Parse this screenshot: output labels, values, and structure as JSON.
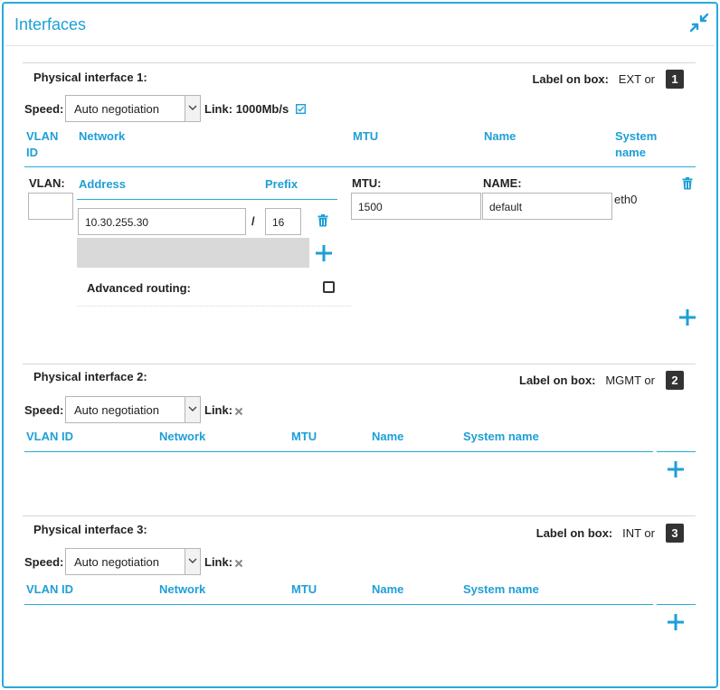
{
  "panel": {
    "title": "Interfaces"
  },
  "icons": {
    "collapse": "collapse-arrows-icon",
    "trash": "trash-icon",
    "plus": "plus-icon",
    "link_checked": "checked-box-icon",
    "link_down": "x-icon"
  },
  "colors": {
    "accent": "#1e9fd6",
    "badge": "#333333"
  },
  "common": {
    "speed_label": "Speed:",
    "link_label": "Link:",
    "label_on_box": "Label on box:",
    "vlan_id": "VLAN ID",
    "network": "Network",
    "mtu": "MTU",
    "name": "Name",
    "system_name": "System name",
    "speed_value": "Auto negotiation"
  },
  "interfaces": [
    {
      "title": "Physical interface 1:",
      "label_value": "EXT or",
      "badge": "1",
      "link_value": "1000Mb/s",
      "columns": {
        "vlan_id": "VLAN ID",
        "network": "Network",
        "mtu": "MTU",
        "name": "Name",
        "system_name": "System name"
      },
      "row": {
        "vlan_label": "VLAN:",
        "vlan_value": "",
        "address_header": "Address",
        "prefix_header": "Prefix",
        "address_value": "10.30.255.30",
        "separator": "/",
        "prefix_value": "16",
        "advanced_routing_label": "Advanced routing:",
        "advanced_routing_checked": false,
        "mtu_label": "MTU:",
        "mtu_value": "1500",
        "name_label": "NAME:",
        "name_value": "default",
        "system_name": "eth0"
      }
    },
    {
      "title": "Physical interface 2:",
      "label_value": "MGMT or",
      "badge": "2",
      "link_value": ""
    },
    {
      "title": "Physical interface 3:",
      "label_value": "INT or",
      "badge": "3",
      "link_value": ""
    }
  ]
}
